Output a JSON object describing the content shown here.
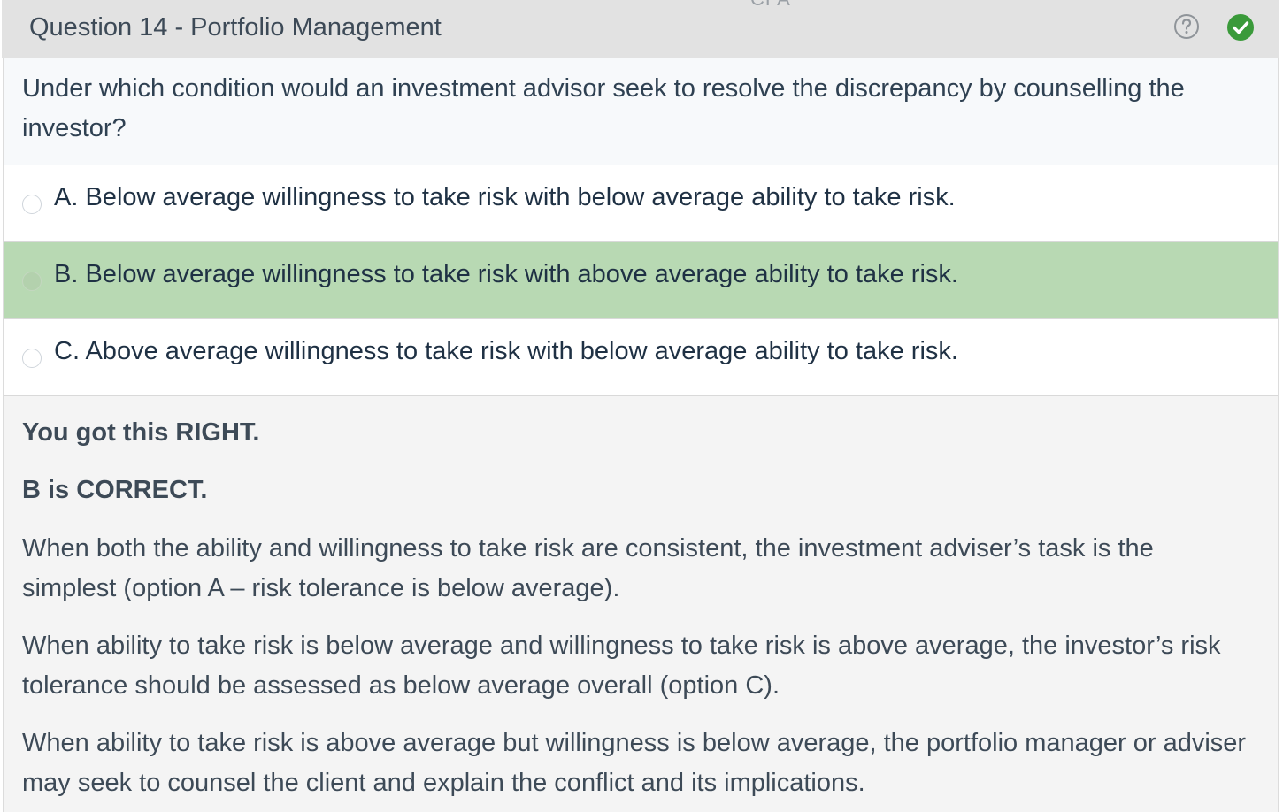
{
  "header": {
    "partial_top_text": "CFA",
    "title": "Question 14 - Portfolio Management",
    "help_icon": "question-circle-icon",
    "status_icon": "check-circle-icon",
    "status_color": "#3a9a3a"
  },
  "question": {
    "text": "Under which condition would an investment advisor seek to resolve the discrepancy by counselling the investor?"
  },
  "options": [
    {
      "letter": "A.",
      "text": "Below average willingness to take risk with below average ability to take risk.",
      "correct": false
    },
    {
      "letter": "B.",
      "text": "Below average willingness to take risk with above average ability to take risk.",
      "correct": true
    },
    {
      "letter": "C.",
      "text": "Above average willingness to take risk with below average ability to take risk.",
      "correct": false
    }
  ],
  "explanation": {
    "result": "You got this RIGHT.",
    "correct_answer": "B is CORRECT.",
    "paragraphs": [
      "When both the ability and willingness to take risk are consistent, the investment adviser’s task is the simplest (option A – risk tolerance is below average).",
      "When ability to take risk is below average and willingness to take risk is above average, the investor’s risk tolerance should be assessed as below average overall (option C).",
      "When ability to take risk is above average but willingness is below average, the portfolio manager or adviser may seek to counsel the client and explain the conflict and its implications."
    ]
  },
  "colors": {
    "correct_option_bg": "#b8d9b3",
    "header_bg": "#e2e2e2",
    "text": "#3d4a57"
  }
}
